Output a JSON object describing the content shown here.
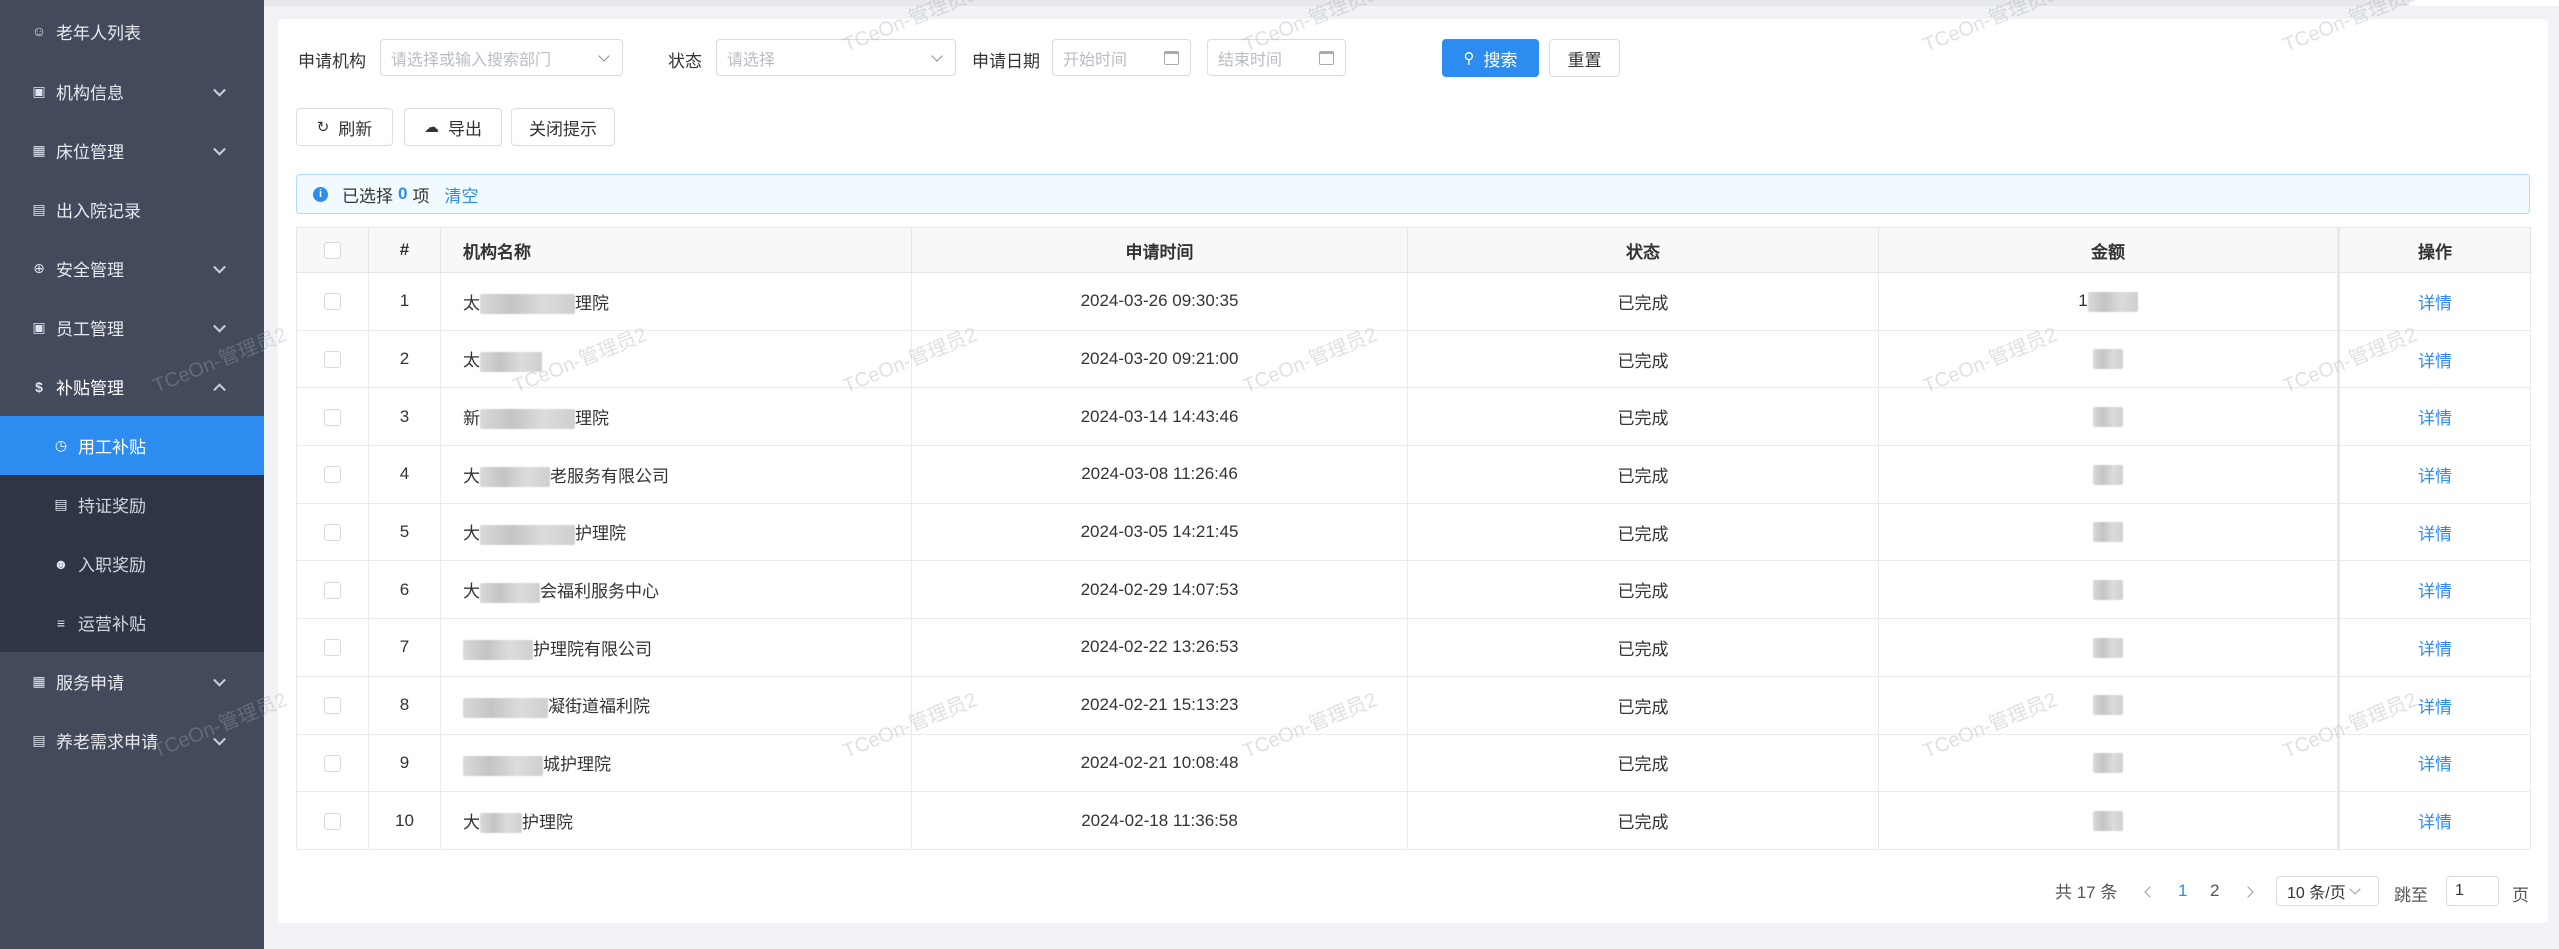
{
  "sidebar": {
    "items": [
      {
        "label": "老年人列表",
        "icon": "people-icon"
      },
      {
        "label": "机构信息",
        "icon": "building-icon"
      },
      {
        "label": "床位管理",
        "icon": "grid-icon"
      },
      {
        "label": "出入院记录",
        "icon": "record-icon"
      },
      {
        "label": "安全管理",
        "icon": "plus-circle-icon"
      },
      {
        "label": "员工管理",
        "icon": "staff-icon"
      },
      {
        "label": "补贴管理",
        "icon": "dollar-icon"
      }
    ],
    "sub_items": [
      {
        "label": "用工补贴",
        "icon": "clock-icon"
      },
      {
        "label": "持证奖励",
        "icon": "card-icon"
      },
      {
        "label": "入职奖励",
        "icon": "user-add-icon"
      },
      {
        "label": "运营补贴",
        "icon": "list-icon"
      }
    ],
    "bottom_items": [
      {
        "label": "服务申请",
        "icon": "calendar-icon"
      },
      {
        "label": "养老需求申请",
        "icon": "doc-icon"
      }
    ]
  },
  "filters": {
    "org_label": "申请机构",
    "org_placeholder": "请选择或输入搜索部门",
    "status_label": "状态",
    "status_placeholder": "请选择",
    "date_label": "申请日期",
    "start_placeholder": "开始时间",
    "end_placeholder": "结束时间",
    "search_label": "搜索",
    "reset_label": "重置"
  },
  "toolbar": {
    "refresh_label": "刷新",
    "export_label": "导出",
    "close_tip_label": "关闭提示"
  },
  "alert": {
    "prefix": "已选择",
    "count": "0",
    "suffix": "项",
    "clear_label": "清空"
  },
  "table": {
    "headers": [
      "#",
      "机构名称",
      "申请时间",
      "状态",
      "金额",
      "操作"
    ],
    "rows": [
      {
        "idx": "1",
        "name_a": "太",
        "name_b": "理院",
        "time": "2024-03-26 09:30:35",
        "status": "已完成",
        "amount": "1",
        "op": "详情"
      },
      {
        "idx": "2",
        "name_a": "太",
        "name_b": "",
        "time": "2024-03-20 09:21:00",
        "status": "已完成",
        "amount": "",
        "op": "详情"
      },
      {
        "idx": "3",
        "name_a": "新",
        "name_b": "理院",
        "time": "2024-03-14 14:43:46",
        "status": "已完成",
        "amount": "",
        "op": "详情"
      },
      {
        "idx": "4",
        "name_a": "大",
        "name_b": "老服务有限公司",
        "time": "2024-03-08 11:26:46",
        "status": "已完成",
        "amount": "",
        "op": "详情"
      },
      {
        "idx": "5",
        "name_a": "大",
        "name_b": "护理院",
        "time": "2024-03-05 14:21:45",
        "status": "已完成",
        "amount": "",
        "op": "详情"
      },
      {
        "idx": "6",
        "name_a": "大",
        "name_b": "会福利服务中心",
        "time": "2024-02-29 14:07:53",
        "status": "已完成",
        "amount": "",
        "op": "详情"
      },
      {
        "idx": "7",
        "name_a": "",
        "name_b": "护理院有限公司",
        "time": "2024-02-22 13:26:53",
        "status": "已完成",
        "amount": "",
        "op": "详情"
      },
      {
        "idx": "8",
        "name_a": "",
        "name_b": "凝街道福利院",
        "time": "2024-02-21 15:13:23",
        "status": "已完成",
        "amount": "",
        "op": "详情"
      },
      {
        "idx": "9",
        "name_a": "",
        "name_b": "城护理院",
        "time": "2024-02-21 10:08:48",
        "status": "已完成",
        "amount": "",
        "op": "详情"
      },
      {
        "idx": "10",
        "name_a": "大",
        "name_b": "护理院",
        "time": "2024-02-18 11:36:58",
        "status": "已完成",
        "amount": "",
        "op": "详情"
      }
    ]
  },
  "pagination": {
    "total": "共 17 条",
    "pages": [
      "1",
      "2"
    ],
    "page_size": "10 条/页",
    "jump_label": "跳至",
    "jump_value": "1",
    "page_suffix": "页"
  },
  "watermark": "TCeOn-管理员2",
  "colors": {
    "accent": "#2d8cf0",
    "sidebar": "#434a5c",
    "submenu": "#2f3544"
  }
}
